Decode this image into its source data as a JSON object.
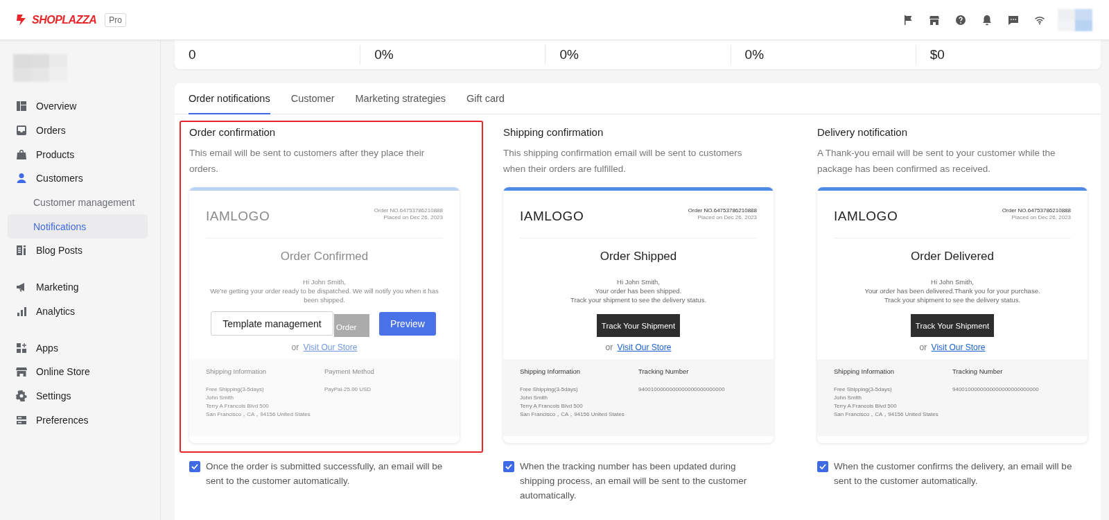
{
  "topbar": {
    "logo": "SHOPLAZZA",
    "plan": "Pro"
  },
  "sidebar": {
    "groups": [
      [
        {
          "label": "Overview",
          "selected": false
        },
        {
          "label": "Orders",
          "selected": false
        },
        {
          "label": "Products",
          "selected": false
        },
        {
          "label": "Customers",
          "selected": true,
          "children": [
            {
              "label": "Customer management",
              "selected": false
            },
            {
              "label": "Notifications",
              "selected": true
            }
          ]
        },
        {
          "label": "Blog Posts",
          "selected": false
        }
      ],
      [
        {
          "label": "Marketing",
          "selected": false
        },
        {
          "label": "Analytics",
          "selected": false
        }
      ],
      [
        {
          "label": "Apps",
          "selected": false
        },
        {
          "label": "Online Store",
          "selected": false
        },
        {
          "label": "Settings",
          "selected": false
        },
        {
          "label": "Preferences",
          "selected": false
        }
      ]
    ]
  },
  "stats": [
    "0",
    "0%",
    "0%",
    "0%",
    "$0"
  ],
  "tabs": [
    {
      "label": "Order notifications",
      "selected": true
    },
    {
      "label": "Customer",
      "selected": false
    },
    {
      "label": "Marketing strategies",
      "selected": false
    },
    {
      "label": "Gift card",
      "selected": false
    }
  ],
  "notifications": [
    {
      "title": "Order confirmation",
      "description": "This email will be sent to customers after they place their orders.",
      "highlighted": true,
      "preview": {
        "faded": true,
        "logo": "IAMLOGO",
        "order_no": "Order NO.64753786210888",
        "placed_on": "Placed on Dec 26, 2023",
        "heading": "Order Confirmed",
        "greeting": "Hi  John Smith,",
        "message": [
          "We're getting your order ready to be dispatched. We will notify you when it has been shipped."
        ],
        "button": "Order",
        "or_text": "or",
        "link": "Visit Our Store",
        "info": [
          {
            "heading": "Shipping Information",
            "lines": [
              "Free Shipping(3-5days)",
              "John Smith",
              "Terry A Francois Blvd 500",
              "San Francisco，CA，94156 United States"
            ]
          },
          {
            "heading": "Payment Method",
            "lines": [
              "PayPal-25.00 USD"
            ]
          }
        ],
        "actions": [
          {
            "label": "Template management",
            "kind": "outline"
          },
          {
            "label": "Preview",
            "kind": "primary"
          }
        ]
      },
      "auto_send": {
        "checked": true,
        "text": "Once the order is submitted successfully, an email will be sent to the customer automatically."
      }
    },
    {
      "title": "Shipping confirmation",
      "description": "This shipping confirmation email will be sent to customers when their orders are fulfilled.",
      "highlighted": false,
      "preview": {
        "faded": false,
        "logo": "IAMLOGO",
        "order_no": "Order NO.64753786210888",
        "placed_on": "Placed on Dec 26, 2023",
        "heading": "Order Shipped",
        "greeting": "Hi  John Smith,",
        "message": [
          "Your order has been shipped.",
          "Track your shipment to see the delivery status."
        ],
        "button": "Track Your Shipment",
        "or_text": "or",
        "link": "Visit Our Store",
        "info": [
          {
            "heading": "Shipping Information",
            "lines": [
              "Free Shipping(3-5days)",
              "John Smith",
              "Terry A Francois Blvd 500",
              "San Francisco，CA，94156 United States"
            ]
          },
          {
            "heading": "Tracking Number",
            "lines": [
              "9400100000000000000000000000"
            ]
          }
        ]
      },
      "auto_send": {
        "checked": true,
        "text": "When the tracking number has been updated during shipping process, an email will be sent to the customer automatically."
      }
    },
    {
      "title": "Delivery notification",
      "description": "A Thank-you email will be sent to your customer while the package has been confirmed as received.",
      "highlighted": false,
      "preview": {
        "faded": false,
        "logo": "IAMLOGO",
        "order_no": "Order NO.64753786210888",
        "placed_on": "Placed on Dec 26, 2023",
        "heading": "Order Delivered",
        "greeting": "Hi  John Smith,",
        "message": [
          "Your order has been delivered.Thank you for your purchase.",
          "Track your shipment to see the delivery status."
        ],
        "button": "Track Your Shipment",
        "or_text": "or",
        "link": "Visit Our Store",
        "info": [
          {
            "heading": "Shipping Information",
            "lines": [
              "Free Shipping(3-5days)",
              "John Smith",
              "Terry A Francois Blvd 500",
              "San Francisco，CA，94156 United States"
            ]
          },
          {
            "heading": "Tracking Number",
            "lines": [
              "9400100000000000000000000000"
            ]
          }
        ]
      },
      "auto_send": {
        "checked": true,
        "text": "When the customer confirms the delivery, an email will be sent to the customer automatically."
      }
    }
  ]
}
